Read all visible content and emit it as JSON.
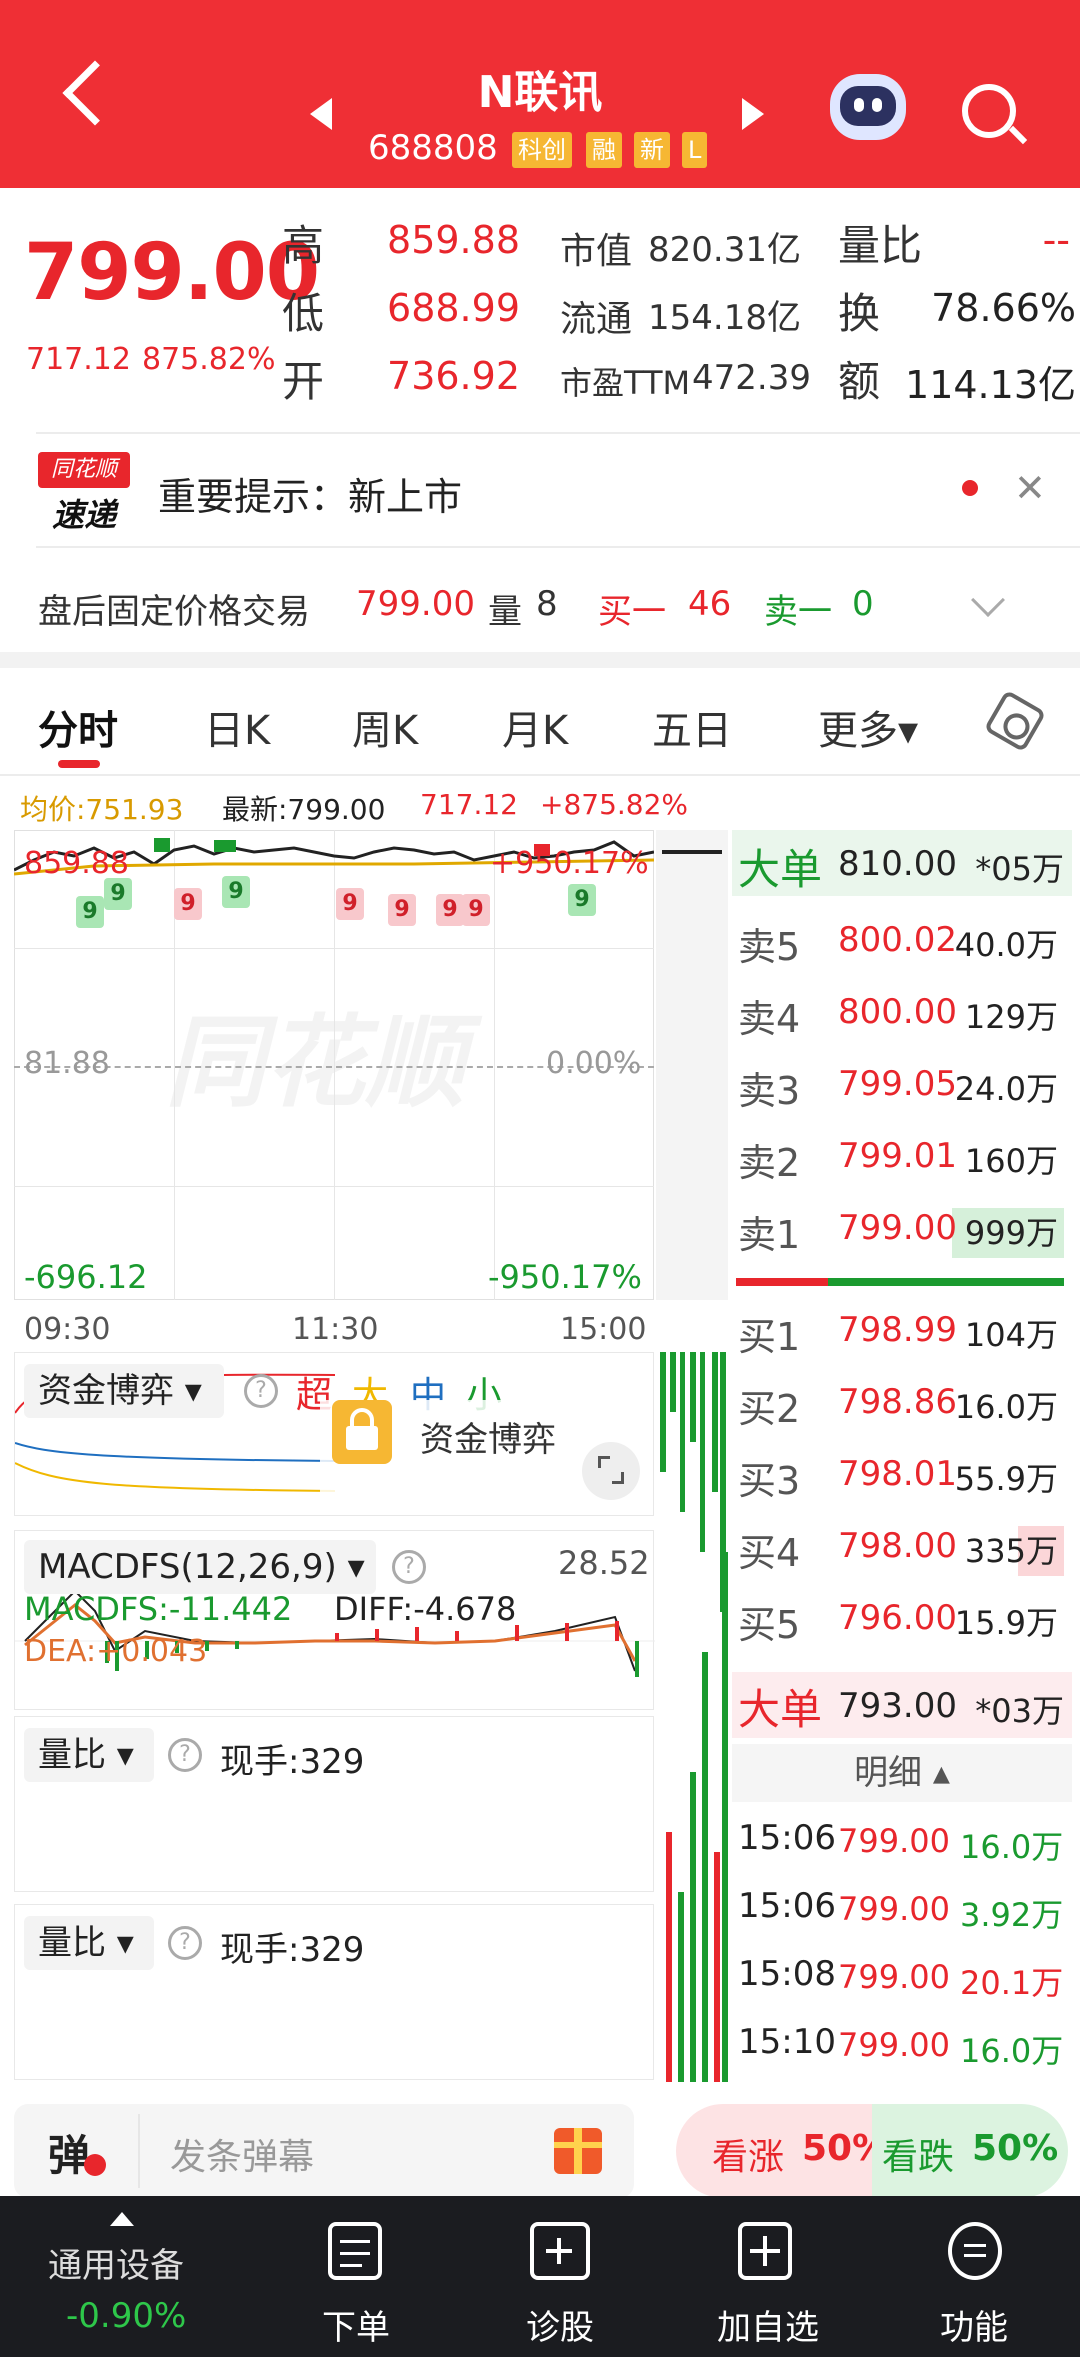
{
  "header": {
    "title": "N联讯",
    "code": "688808",
    "tags": [
      "科创",
      "融",
      "新",
      "L"
    ]
  },
  "quote": {
    "price": "799.00",
    "change": "717.12",
    "change_pct": "875.82%",
    "high_label": "高",
    "high": "859.88",
    "low_label": "低",
    "low": "688.99",
    "open_label": "开",
    "open": "736.92",
    "mcap_label": "市值",
    "mcap": "820.31亿",
    "float_label": "流通",
    "float": "154.18亿",
    "pe_label": "市盈TTM",
    "pe": "472.39",
    "vol_ratio_label": "量比",
    "vol_ratio": "--",
    "turnover_label": "换",
    "turnover": "78.66%",
    "amount_label": "额",
    "amount": "114.13亿"
  },
  "notice": {
    "logo_top": "同花顺",
    "logo_bottom": "速递",
    "text": "重要提示：新上市"
  },
  "after_hours": {
    "label": "盘后固定价格交易",
    "price": "799.00",
    "vol_label": "量",
    "vol": "8",
    "buy_label": "买一",
    "buy": "46",
    "sell_label": "卖一",
    "sell": "0"
  },
  "tabs": [
    "分时",
    "日K",
    "周K",
    "月K",
    "五日",
    "更多▾"
  ],
  "chart": {
    "avg_label": "均价:751.93",
    "latest_label": "最新:799.00",
    "change": "717.12",
    "change_pct": "+875.82%",
    "y_top": "859.88",
    "y_mid": "81.88",
    "y_bot": "-696.12",
    "pct_top": "+950.17%",
    "pct_mid": "0.00%",
    "pct_bot": "-950.17%",
    "t_start": "09:30",
    "t_mid": "11:30",
    "t_end": "15:00",
    "watermark": "同花顺",
    "markers": [
      "9",
      "9",
      "9",
      "9",
      "9",
      "9",
      "9",
      "9",
      "9"
    ]
  },
  "capital": {
    "label": "资金博弈",
    "legend": [
      "超",
      "大",
      "中",
      "小"
    ],
    "lock_text": "资金博弈"
  },
  "macd": {
    "label": "MACDFS(12,26,9)",
    "value_top": "28.52",
    "macd": "MACDFS:-11.442",
    "diff": "DIFF:-4.678",
    "dea": "DEA:+0.043"
  },
  "vol_panels": [
    {
      "label": "量比",
      "hand": "现手:329"
    },
    {
      "label": "量比",
      "hand": "现手:329"
    }
  ],
  "orderbook": {
    "big_top": {
      "label": "大单",
      "price": "810.00",
      "vol": "*05万"
    },
    "sells": [
      {
        "label": "卖5",
        "price": "800.02",
        "vol": "40.0万"
      },
      {
        "label": "卖4",
        "price": "800.00",
        "vol": "129万"
      },
      {
        "label": "卖3",
        "price": "799.05",
        "vol": "24.0万"
      },
      {
        "label": "卖2",
        "price": "799.01",
        "vol": "160万"
      },
      {
        "label": "卖1",
        "price": "799.00",
        "vol": "999万"
      }
    ],
    "buys": [
      {
        "label": "买1",
        "price": "798.99",
        "vol": "104万"
      },
      {
        "label": "买2",
        "price": "798.86",
        "vol": "16.0万"
      },
      {
        "label": "买3",
        "price": "798.01",
        "vol": "55.9万"
      },
      {
        "label": "买4",
        "price": "798.00",
        "vol": "335万"
      },
      {
        "label": "买5",
        "price": "796.00",
        "vol": "15.9万"
      }
    ],
    "big_bottom": {
      "label": "大单",
      "price": "793.00",
      "vol": "*03万"
    },
    "detail_label": "明细 ▴",
    "ticks": [
      {
        "time": "15:06",
        "price": "799.00",
        "vol": "16.0万"
      },
      {
        "time": "15:06",
        "price": "799.00",
        "vol": "3.92万"
      },
      {
        "time": "15:08",
        "price": "799.00",
        "vol": "20.1万"
      },
      {
        "time": "15:10",
        "price": "799.00",
        "vol": "16.0万"
      }
    ]
  },
  "danmu": {
    "icon_text": "弹",
    "placeholder": "发条弹幕"
  },
  "vote": {
    "up_label": "看涨",
    "up_pct": "50%",
    "down_label": "看跌",
    "down_pct": "50%"
  },
  "navbar": {
    "index_label": "通用设备",
    "index_pct": "-0.90%",
    "items": [
      "下单",
      "诊股",
      "加自选",
      "功能"
    ]
  },
  "colors": {
    "header": "#ef2f35",
    "up": "#e8262c",
    "down": "#1a9a2f",
    "avg_line": "#e0a800"
  }
}
